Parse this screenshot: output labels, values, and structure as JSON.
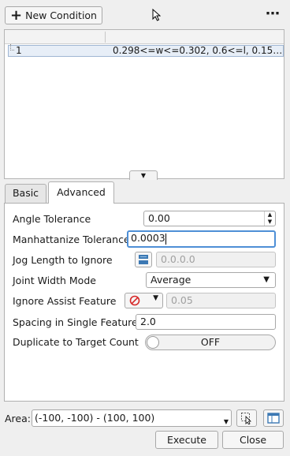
{
  "toolbar": {
    "new_condition_label": "New Condition",
    "more_label": "⋯"
  },
  "conditions": {
    "rows": [
      {
        "index": "1",
        "value": "0.298<=w<=0.302, 0.6<=l, 0.15…"
      }
    ]
  },
  "tabs": {
    "basic": "Basic",
    "advanced": "Advanced"
  },
  "advanced": {
    "angle_tolerance": {
      "label": "Angle Tolerance",
      "value": "0.00"
    },
    "manhattanize_tolerance": {
      "label": "Manhattanize Tolerance",
      "value": "0.0003"
    },
    "jog_length": {
      "label": "Jog Length to Ignore",
      "value": "0.0.0.0"
    },
    "joint_width_mode": {
      "label": "Joint Width Mode",
      "value": "Average"
    },
    "ignore_assist": {
      "label": "Ignore Assist Feature",
      "value": "0.05"
    },
    "spacing_single": {
      "label": "Spacing in Single Feature",
      "value": "2.0"
    },
    "duplicate_target": {
      "label": "Duplicate to Target Count",
      "value": "OFF"
    }
  },
  "footer": {
    "area_label": "Area:",
    "area_value": "(-100, -100) - (100, 100)",
    "execute_label": "Execute",
    "close_label": "Close"
  },
  "colors": {
    "focus": "#4e8fd6",
    "selection": "#e7eef7",
    "forbidden": "#d62a2a",
    "layer_icon": "#3c79b4"
  }
}
